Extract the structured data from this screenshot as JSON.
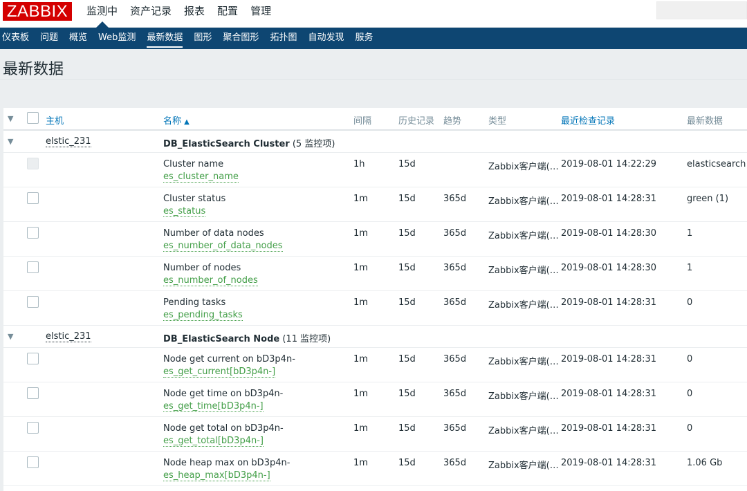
{
  "logo": "ZABBIX",
  "top_menu": [
    "监测中",
    "资产记录",
    "报表",
    "配置",
    "管理"
  ],
  "sub_menu": [
    "仪表板",
    "问题",
    "概览",
    "Web监测",
    "最新数据",
    "图形",
    "聚合图形",
    "拓扑图",
    "自动发现",
    "服务"
  ],
  "page_title": "最新数据",
  "table": {
    "headers": {
      "host": "主机",
      "name": "名称",
      "sort_indicator": "▲",
      "interval": "间隔",
      "history": "历史记录",
      "trends": "趋势",
      "type": "类型",
      "last_check": "最近检查记录",
      "last_value": "最新数据"
    },
    "groups": [
      {
        "host": "elstic_231",
        "app": "DB_ElasticSearch Cluster",
        "count": "(5 监控项)",
        "items": [
          {
            "name": "Cluster name",
            "key": "es_cluster_name",
            "interval": "1h",
            "history": "15d",
            "trends": "",
            "type": "Zabbix客户端(…",
            "last_check": "2019-08-01 14:22:29",
            "last_value": "elasticsearch",
            "disabled": true
          },
          {
            "name": "Cluster status",
            "key": "es_status",
            "interval": "1m",
            "history": "15d",
            "trends": "365d",
            "type": "Zabbix客户端(…",
            "last_check": "2019-08-01 14:28:31",
            "last_value": "green (1)",
            "disabled": false
          },
          {
            "name": "Number of data nodes",
            "key": "es_number_of_data_nodes",
            "interval": "1m",
            "history": "15d",
            "trends": "365d",
            "type": "Zabbix客户端(…",
            "last_check": "2019-08-01 14:28:30",
            "last_value": "1",
            "disabled": false
          },
          {
            "name": "Number of nodes",
            "key": "es_number_of_nodes",
            "interval": "1m",
            "history": "15d",
            "trends": "365d",
            "type": "Zabbix客户端(…",
            "last_check": "2019-08-01 14:28:30",
            "last_value": "1",
            "disabled": false
          },
          {
            "name": "Pending tasks",
            "key": "es_pending_tasks",
            "interval": "1m",
            "history": "15d",
            "trends": "365d",
            "type": "Zabbix客户端(…",
            "last_check": "2019-08-01 14:28:31",
            "last_value": "0",
            "disabled": false
          }
        ]
      },
      {
        "host": "elstic_231",
        "app": "DB_ElasticSearch Node",
        "count": "(11 监控项)",
        "items": [
          {
            "name": "Node get current on bD3p4n-",
            "key": "es_get_current[bD3p4n-]",
            "interval": "1m",
            "history": "15d",
            "trends": "365d",
            "type": "Zabbix客户端(…",
            "last_check": "2019-08-01 14:28:31",
            "last_value": "0",
            "disabled": false
          },
          {
            "name": "Node get time on bD3p4n-",
            "key": "es_get_time[bD3p4n-]",
            "interval": "1m",
            "history": "15d",
            "trends": "365d",
            "type": "Zabbix客户端(…",
            "last_check": "2019-08-01 14:28:31",
            "last_value": "0",
            "disabled": false
          },
          {
            "name": "Node get total on bD3p4n-",
            "key": "es_get_total[bD3p4n-]",
            "interval": "1m",
            "history": "15d",
            "trends": "365d",
            "type": "Zabbix客户端(…",
            "last_check": "2019-08-01 14:28:31",
            "last_value": "0",
            "disabled": false
          },
          {
            "name": "Node heap max on bD3p4n-",
            "key": "es_heap_max[bD3p4n-]",
            "interval": "1m",
            "history": "15d",
            "trends": "365d",
            "type": "Zabbix客户端(…",
            "last_check": "2019-08-01 14:28:31",
            "last_value": "1.06 Gb",
            "disabled": false
          }
        ]
      }
    ]
  },
  "colors": {
    "brand": "#d40000",
    "nav": "#0e4672",
    "link": "#0275b8",
    "key": "#429e47"
  }
}
